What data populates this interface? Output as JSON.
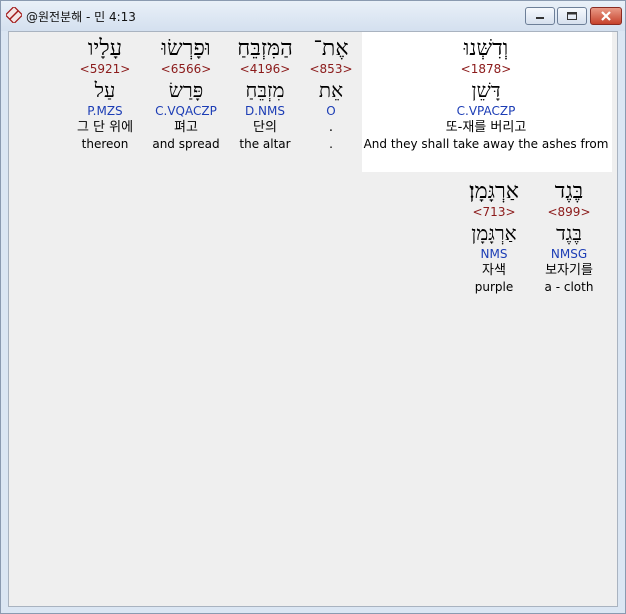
{
  "window": {
    "title": "@원전분해 - 민 4:13",
    "accent_color": "#c6422c"
  },
  "words": [
    {
      "hebrew": "וְדִשְּׁנוּ",
      "strong": "<1878>",
      "lemma": "דָּשֵׁן",
      "parse": "C.VPACZP",
      "korean": "또-재를 버리고",
      "english": "And they shall take away the ashes from",
      "selected": true
    },
    {
      "hebrew": "אֶת־",
      "strong": "<853>",
      "lemma": "אֵת",
      "parse": "O",
      "korean": ".",
      "english": ".",
      "selected": false
    },
    {
      "hebrew": "הַמִּזְבֵּחַ",
      "strong": "<4196>",
      "lemma": "מִזְבֵּחַ",
      "parse": "D.NMS",
      "korean": "단의",
      "english": "the altar",
      "selected": false
    },
    {
      "hebrew": "וּפָרְשׂוּ",
      "strong": "<6566>",
      "lemma": "פָּרַשׂ",
      "parse": "C.VQACZP",
      "korean": "펴고",
      "english": "and spread",
      "selected": false
    },
    {
      "hebrew": "עָלָיו",
      "strong": "<5921>",
      "lemma": "עַל",
      "parse": "P.MZS",
      "korean": "그 단 위에",
      "english": "thereon",
      "selected": false
    },
    {
      "hebrew": "בֶּגֶד",
      "strong": "<899>",
      "lemma": "בֶּגֶד",
      "parse": "NMSG",
      "korean": "보자기를",
      "english": "a - cloth",
      "selected": false
    },
    {
      "hebrew": "אַרְגָּמָן׃",
      "strong": "<713>",
      "lemma": "אַרְגָּמָן",
      "parse": "NMS",
      "korean": "자색",
      "english": "purple",
      "selected": false
    }
  ],
  "icons": {
    "app": "app-logo-icon",
    "minimize": "minimize-icon",
    "maximize": "maximize-icon",
    "close": "close-icon"
  }
}
